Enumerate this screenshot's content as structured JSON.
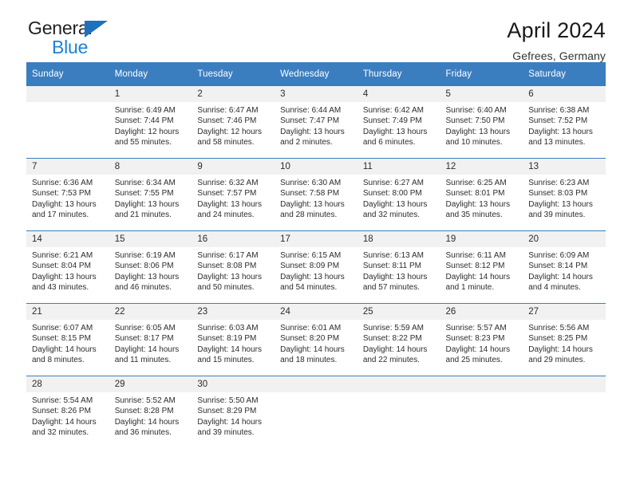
{
  "brand": {
    "name_top": "General",
    "name_bottom": "Blue",
    "color_dark": "#231f20",
    "color_blue": "#1e83d4"
  },
  "header": {
    "title": "April 2024",
    "location": "Gefrees, Germany",
    "accent_color": "#3b7ec0"
  },
  "calendar": {
    "weekday_headers": [
      "Sunday",
      "Monday",
      "Tuesday",
      "Wednesday",
      "Thursday",
      "Friday",
      "Saturday"
    ],
    "weeks": [
      [
        {
          "day": "",
          "sunrise": "",
          "sunset": "",
          "daylight1": "",
          "daylight2": "",
          "empty": true
        },
        {
          "day": "1",
          "sunrise": "Sunrise: 6:49 AM",
          "sunset": "Sunset: 7:44 PM",
          "daylight1": "Daylight: 12 hours",
          "daylight2": "and 55 minutes."
        },
        {
          "day": "2",
          "sunrise": "Sunrise: 6:47 AM",
          "sunset": "Sunset: 7:46 PM",
          "daylight1": "Daylight: 12 hours",
          "daylight2": "and 58 minutes."
        },
        {
          "day": "3",
          "sunrise": "Sunrise: 6:44 AM",
          "sunset": "Sunset: 7:47 PM",
          "daylight1": "Daylight: 13 hours",
          "daylight2": "and 2 minutes."
        },
        {
          "day": "4",
          "sunrise": "Sunrise: 6:42 AM",
          "sunset": "Sunset: 7:49 PM",
          "daylight1": "Daylight: 13 hours",
          "daylight2": "and 6 minutes."
        },
        {
          "day": "5",
          "sunrise": "Sunrise: 6:40 AM",
          "sunset": "Sunset: 7:50 PM",
          "daylight1": "Daylight: 13 hours",
          "daylight2": "and 10 minutes."
        },
        {
          "day": "6",
          "sunrise": "Sunrise: 6:38 AM",
          "sunset": "Sunset: 7:52 PM",
          "daylight1": "Daylight: 13 hours",
          "daylight2": "and 13 minutes."
        }
      ],
      [
        {
          "day": "7",
          "sunrise": "Sunrise: 6:36 AM",
          "sunset": "Sunset: 7:53 PM",
          "daylight1": "Daylight: 13 hours",
          "daylight2": "and 17 minutes."
        },
        {
          "day": "8",
          "sunrise": "Sunrise: 6:34 AM",
          "sunset": "Sunset: 7:55 PM",
          "daylight1": "Daylight: 13 hours",
          "daylight2": "and 21 minutes."
        },
        {
          "day": "9",
          "sunrise": "Sunrise: 6:32 AM",
          "sunset": "Sunset: 7:57 PM",
          "daylight1": "Daylight: 13 hours",
          "daylight2": "and 24 minutes."
        },
        {
          "day": "10",
          "sunrise": "Sunrise: 6:30 AM",
          "sunset": "Sunset: 7:58 PM",
          "daylight1": "Daylight: 13 hours",
          "daylight2": "and 28 minutes."
        },
        {
          "day": "11",
          "sunrise": "Sunrise: 6:27 AM",
          "sunset": "Sunset: 8:00 PM",
          "daylight1": "Daylight: 13 hours",
          "daylight2": "and 32 minutes."
        },
        {
          "day": "12",
          "sunrise": "Sunrise: 6:25 AM",
          "sunset": "Sunset: 8:01 PM",
          "daylight1": "Daylight: 13 hours",
          "daylight2": "and 35 minutes."
        },
        {
          "day": "13",
          "sunrise": "Sunrise: 6:23 AM",
          "sunset": "Sunset: 8:03 PM",
          "daylight1": "Daylight: 13 hours",
          "daylight2": "and 39 minutes."
        }
      ],
      [
        {
          "day": "14",
          "sunrise": "Sunrise: 6:21 AM",
          "sunset": "Sunset: 8:04 PM",
          "daylight1": "Daylight: 13 hours",
          "daylight2": "and 43 minutes."
        },
        {
          "day": "15",
          "sunrise": "Sunrise: 6:19 AM",
          "sunset": "Sunset: 8:06 PM",
          "daylight1": "Daylight: 13 hours",
          "daylight2": "and 46 minutes."
        },
        {
          "day": "16",
          "sunrise": "Sunrise: 6:17 AM",
          "sunset": "Sunset: 8:08 PM",
          "daylight1": "Daylight: 13 hours",
          "daylight2": "and 50 minutes."
        },
        {
          "day": "17",
          "sunrise": "Sunrise: 6:15 AM",
          "sunset": "Sunset: 8:09 PM",
          "daylight1": "Daylight: 13 hours",
          "daylight2": "and 54 minutes."
        },
        {
          "day": "18",
          "sunrise": "Sunrise: 6:13 AM",
          "sunset": "Sunset: 8:11 PM",
          "daylight1": "Daylight: 13 hours",
          "daylight2": "and 57 minutes."
        },
        {
          "day": "19",
          "sunrise": "Sunrise: 6:11 AM",
          "sunset": "Sunset: 8:12 PM",
          "daylight1": "Daylight: 14 hours",
          "daylight2": "and 1 minute."
        },
        {
          "day": "20",
          "sunrise": "Sunrise: 6:09 AM",
          "sunset": "Sunset: 8:14 PM",
          "daylight1": "Daylight: 14 hours",
          "daylight2": "and 4 minutes."
        }
      ],
      [
        {
          "day": "21",
          "sunrise": "Sunrise: 6:07 AM",
          "sunset": "Sunset: 8:15 PM",
          "daylight1": "Daylight: 14 hours",
          "daylight2": "and 8 minutes."
        },
        {
          "day": "22",
          "sunrise": "Sunrise: 6:05 AM",
          "sunset": "Sunset: 8:17 PM",
          "daylight1": "Daylight: 14 hours",
          "daylight2": "and 11 minutes."
        },
        {
          "day": "23",
          "sunrise": "Sunrise: 6:03 AM",
          "sunset": "Sunset: 8:19 PM",
          "daylight1": "Daylight: 14 hours",
          "daylight2": "and 15 minutes."
        },
        {
          "day": "24",
          "sunrise": "Sunrise: 6:01 AM",
          "sunset": "Sunset: 8:20 PM",
          "daylight1": "Daylight: 14 hours",
          "daylight2": "and 18 minutes."
        },
        {
          "day": "25",
          "sunrise": "Sunrise: 5:59 AM",
          "sunset": "Sunset: 8:22 PM",
          "daylight1": "Daylight: 14 hours",
          "daylight2": "and 22 minutes."
        },
        {
          "day": "26",
          "sunrise": "Sunrise: 5:57 AM",
          "sunset": "Sunset: 8:23 PM",
          "daylight1": "Daylight: 14 hours",
          "daylight2": "and 25 minutes."
        },
        {
          "day": "27",
          "sunrise": "Sunrise: 5:56 AM",
          "sunset": "Sunset: 8:25 PM",
          "daylight1": "Daylight: 14 hours",
          "daylight2": "and 29 minutes."
        }
      ],
      [
        {
          "day": "28",
          "sunrise": "Sunrise: 5:54 AM",
          "sunset": "Sunset: 8:26 PM",
          "daylight1": "Daylight: 14 hours",
          "daylight2": "and 32 minutes."
        },
        {
          "day": "29",
          "sunrise": "Sunrise: 5:52 AM",
          "sunset": "Sunset: 8:28 PM",
          "daylight1": "Daylight: 14 hours",
          "daylight2": "and 36 minutes."
        },
        {
          "day": "30",
          "sunrise": "Sunrise: 5:50 AM",
          "sunset": "Sunset: 8:29 PM",
          "daylight1": "Daylight: 14 hours",
          "daylight2": "and 39 minutes."
        },
        {
          "day": "",
          "sunrise": "",
          "sunset": "",
          "daylight1": "",
          "daylight2": "",
          "empty": true
        },
        {
          "day": "",
          "sunrise": "",
          "sunset": "",
          "daylight1": "",
          "daylight2": "",
          "empty": true
        },
        {
          "day": "",
          "sunrise": "",
          "sunset": "",
          "daylight1": "",
          "daylight2": "",
          "empty": true
        },
        {
          "day": "",
          "sunrise": "",
          "sunset": "",
          "daylight1": "",
          "daylight2": "",
          "empty": true
        }
      ]
    ]
  }
}
